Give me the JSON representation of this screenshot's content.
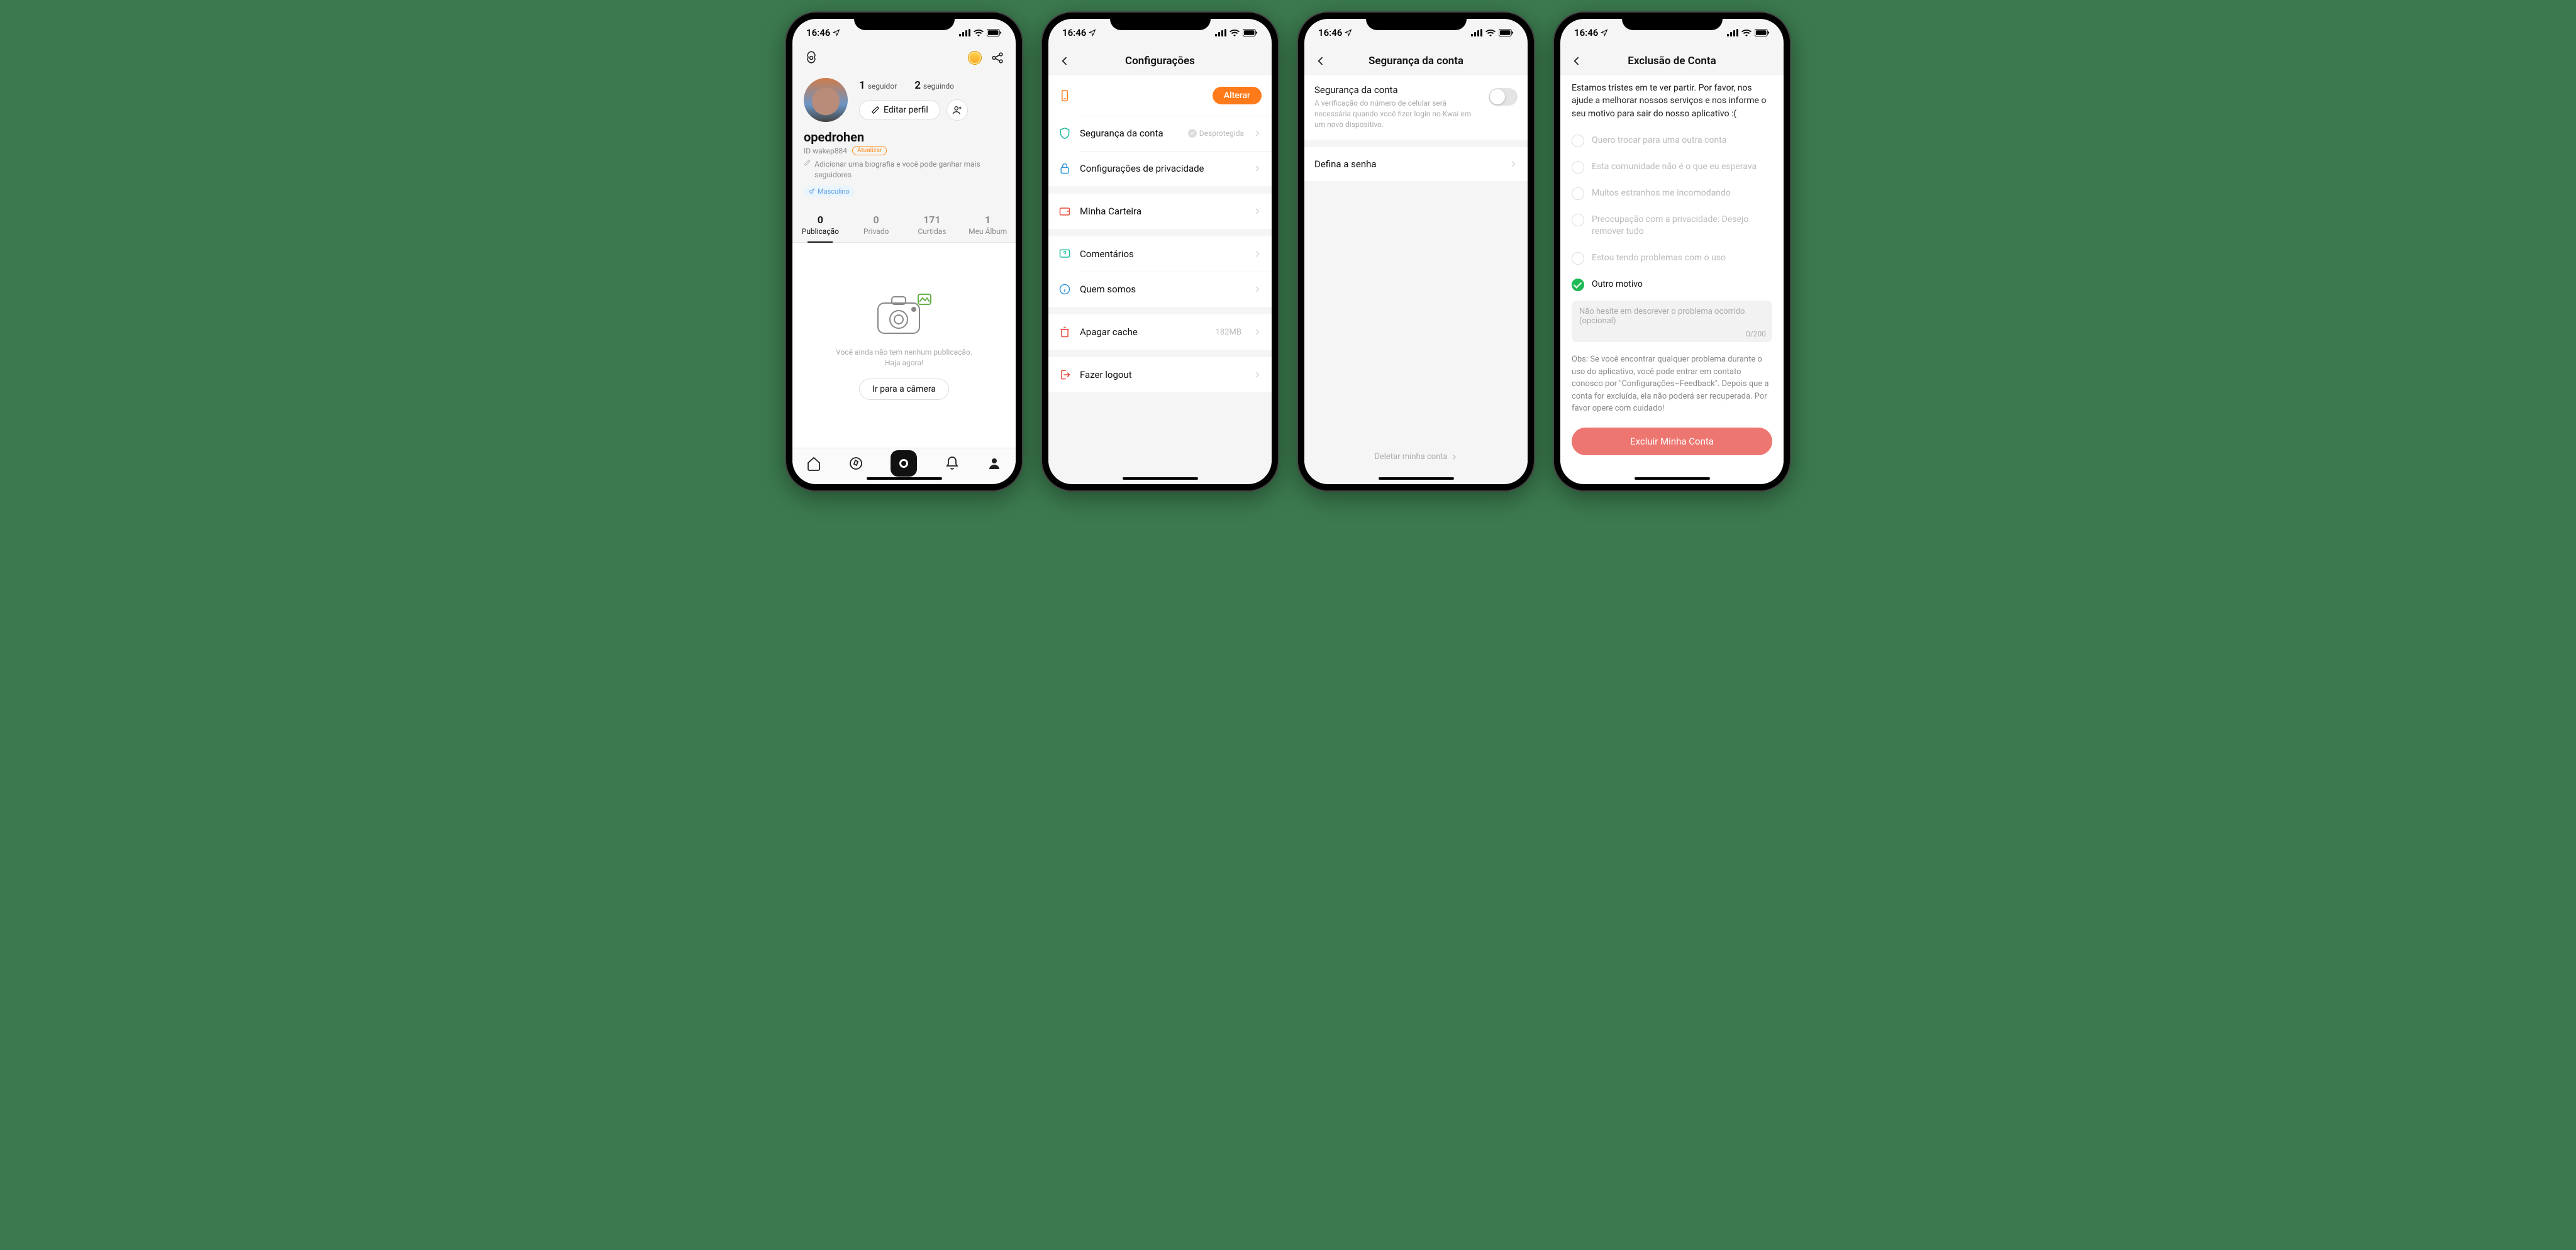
{
  "status": {
    "time": "16:46"
  },
  "screen1": {
    "follower_count": "1",
    "follower_label": "seguidor",
    "following_count": "2",
    "following_label": "seguindo",
    "edit_label": "Editar perfil",
    "username": "opedrohen",
    "id_text": "ID wakep884",
    "update_badge": "Atualizar",
    "bio_hint": "Adicionar uma biografia e você pode ganhar mais seguidores",
    "gender": "Masculino",
    "tabs": [
      {
        "count": "0",
        "label": "Publicação"
      },
      {
        "count": "0",
        "label": "Privado"
      },
      {
        "count": "171",
        "label": "Curtidas"
      },
      {
        "count": "1",
        "label": "Meu Álbum"
      }
    ],
    "empty_line1": "Você ainda não tem nenhum publicação.",
    "empty_line2": "Haja agora!",
    "camera_btn": "Ir para a câmera"
  },
  "screen2": {
    "title": "Configurações",
    "alterar": "Alterar",
    "rows": {
      "security": "Segurança da conta",
      "security_status": "Desprotegida",
      "privacy": "Configurações de privacidade",
      "wallet": "Minha Carteira",
      "comments": "Comentários",
      "about": "Quem somos",
      "cache": "Apagar cache",
      "cache_size": "182MB",
      "logout": "Fazer logout"
    }
  },
  "screen3": {
    "title": "Segurança da conta",
    "sec_title": "Segurança da conta",
    "sec_desc": "A verificação do número de celular será necessária quando você fizer login no Kwai em um novo dispositivo.",
    "password": "Defina a senha",
    "delete_link": "Deletar minha conta"
  },
  "screen4": {
    "title": "Exclusão de Conta",
    "intro": "Estamos tristes em te ver partir. Por favor, nos ajude a melhorar nossos serviços e nos informe o seu motivo para sair do nosso aplicativo :(",
    "reasons": [
      "Quero trocar para uma outra conta",
      "Esta comunidade não é o que eu esperava",
      "Muitos estranhos me incomodando",
      "Preocupação com a privacidade: Desejo remover tudo",
      "Estou tendo problemas com o uso",
      "Outro motivo"
    ],
    "placeholder": "Não hesite em descrever o problema ocorrido (opcional)",
    "counter": "0/200",
    "note": "Obs: Se você encontrar qualquer problema durante o uso do aplicativo, você pode entrar em contato conosco por \"Configurações–Feedback\". Depois que a conta for excluída, ela não poderá ser recuperada. Por favor opere com cuidado!",
    "delete_btn": "Excluir Minha Conta"
  }
}
